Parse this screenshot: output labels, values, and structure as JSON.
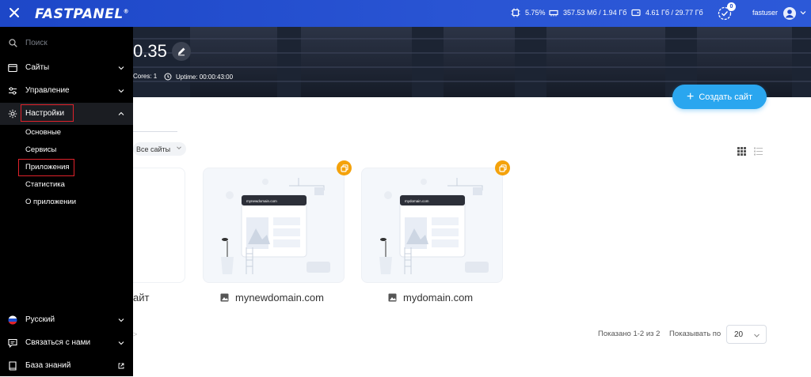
{
  "app": {
    "logo": "FASTPANEL",
    "logo_mark": "®"
  },
  "topbar": {
    "cpu": "5.75%",
    "ram": "357.53 Мб / 1.94 Гб",
    "disk": "4.61 Гб / 29.77 Гб",
    "notifications": "0",
    "user": "fastuser"
  },
  "hero": {
    "title": "0.35",
    "cores": "Cores: 1",
    "uptime": "Uptime: 00:00:43:00"
  },
  "actions": {
    "create_site": "Создать сайт"
  },
  "filter": {
    "label": "Все сайты"
  },
  "sites": [
    {
      "name": "mynewdomain.com",
      "preview_text": "mynewdomain.com"
    },
    {
      "name": "mydomain.com",
      "preview_text": "mydomain.com"
    }
  ],
  "partial_card_label": "айт",
  "pagination": {
    "shown": "Показано 1-2 из 2",
    "per_page_label": "Показывать по",
    "per_page_value": "20"
  },
  "sidebar": {
    "search_placeholder": "Поиск",
    "items": [
      {
        "label": "Сайты",
        "icon": "sites-icon"
      },
      {
        "label": "Управление",
        "icon": "sliders-icon"
      },
      {
        "label": "Настройки",
        "icon": "gear-icon"
      }
    ],
    "settings_sub": [
      "Основные",
      "Сервисы",
      "Приложения",
      "Статистика",
      "О приложении"
    ],
    "bottom": [
      {
        "label": "Русский",
        "icon": "flag-ru-icon"
      },
      {
        "label": "Связаться с нами",
        "icon": "chat-icon"
      },
      {
        "label": "База знаний",
        "icon": "book-icon"
      }
    ]
  },
  "colors": {
    "topbar": "#1d47c8",
    "accent": "#2aa6ef",
    "badge": "#f4a20b",
    "highlight": "#e0222b"
  }
}
